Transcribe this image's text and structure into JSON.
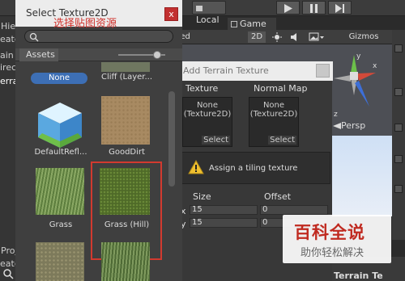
{
  "background": {
    "top_bar": {
      "local_label": "Local"
    },
    "left_panel_fragments": [
      "Hiera",
      "eate",
      "ain C",
      "irect",
      "erra",
      "Proj",
      "eate"
    ],
    "game_tab": "Game",
    "scene_toolbar": {
      "ned_label": "ned",
      "mode_2d": "2D",
      "gizmos_label": "Gizmos"
    },
    "persp_label": "Persp",
    "terrain_label": "Terrain Te"
  },
  "select_texture_window": {
    "title": "Select Texture2D",
    "close_label": "x",
    "assets_tab": "Assets",
    "items": [
      {
        "label": "None",
        "icon": "none-pill"
      },
      {
        "label": "Cliff (Layer...",
        "icon": "cliff-texture"
      },
      {
        "label": "DefaultRefl...",
        "icon": "default-reflection-cube"
      },
      {
        "label": "GoodDirt",
        "icon": "dirt-texture"
      },
      {
        "label": "Grass",
        "icon": "grass-texture"
      },
      {
        "label": "Grass (Hill)",
        "icon": "grass-hill-texture",
        "highlighted": true
      }
    ]
  },
  "annotation": {
    "text": "选择贴图资源",
    "color": "#d0302a"
  },
  "add_terrain_texture": {
    "title": "Add Terrain Texture",
    "texture_label": "Texture",
    "normal_map_label": "Normal Map",
    "texture_slot": {
      "value_line1": "None",
      "value_line2": "(Texture2D)",
      "select": "Select"
    },
    "normal_slot": {
      "value_line1": "None",
      "value_line2": "(Texture2D)",
      "select": "Select"
    },
    "warning": "Assign a tiling texture",
    "size_label": "Size",
    "offset_label": "Offset",
    "x_label": "x",
    "y_label": "y",
    "size_x": "15",
    "size_y": "15",
    "offset_x": "0",
    "offset_y": "0"
  },
  "watermark": {
    "title": "百科全说",
    "subtitle": "助你轻松解决"
  },
  "colors": {
    "highlight": "#d23a2f",
    "none_pill": "#3d6fb5",
    "window_close": "#c23030"
  }
}
